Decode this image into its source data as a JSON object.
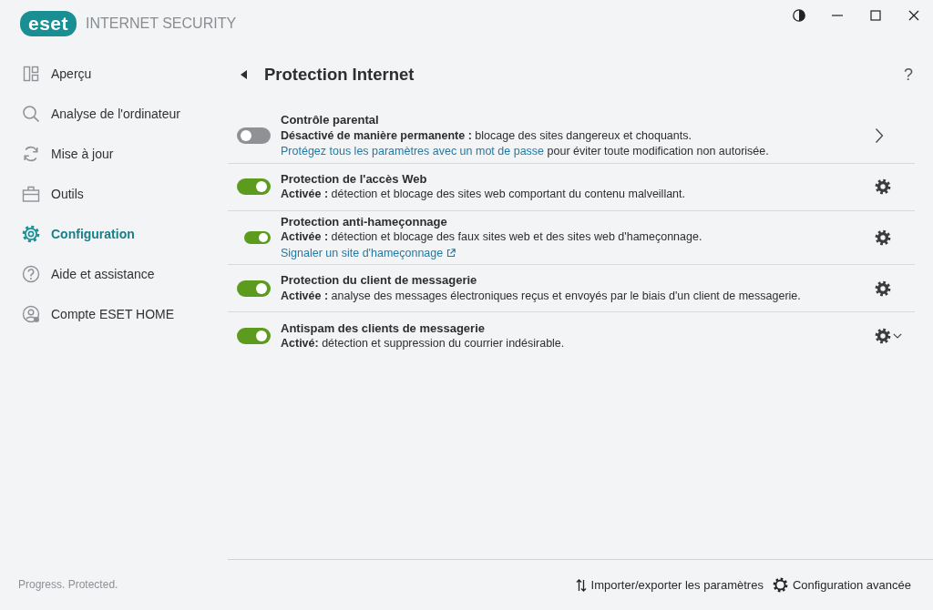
{
  "window": {
    "logo": "eset",
    "product": "INTERNET SECURITY"
  },
  "sidebar": {
    "items": [
      {
        "label": "Aperçu",
        "selected": false
      },
      {
        "label": "Analyse de l'ordinateur",
        "selected": false
      },
      {
        "label": "Mise à jour",
        "selected": false
      },
      {
        "label": "Outils",
        "selected": false
      },
      {
        "label": "Configuration",
        "selected": true
      },
      {
        "label": "Aide et assistance",
        "selected": false
      },
      {
        "label": "Compte ESET HOME",
        "selected": false
      }
    ],
    "tagline": "Progress. Protected."
  },
  "page": {
    "title": "Protection Internet",
    "help": "?"
  },
  "settings": [
    {
      "title": "Contrôle parental",
      "switch": {
        "kind": "regular",
        "on": false
      },
      "kind": "page",
      "status": "**Désactivé de manière permanente :** blocage des sites dangereux et choquants.",
      "note": {
        "link": "Protégez tous les paramètres avec un mot de passe",
        "external": false,
        "after": "pour éviter toute modification non autorisée."
      }
    },
    {
      "title": "Protection de l'accès Web",
      "switch": {
        "kind": "regular",
        "on": true
      },
      "kind": "settings",
      "status": "**Activée :** détection et blocage des sites web comportant du contenu malveillant."
    },
    {
      "title": "Protection anti-hameçonnage",
      "switch": {
        "kind": "small",
        "on": true
      },
      "kind": "settings",
      "status": "**Activée :** détection et blocage des faux sites web et des sites web d'hameçonnage.",
      "note": {
        "link": "Signaler un site d'hameçonnage",
        "external": true
      }
    },
    {
      "title": "Protection du client de messagerie",
      "switch": {
        "kind": "regular",
        "on": true
      },
      "kind": "settings",
      "status": "**Activée :** analyse des messages électroniques reçus et envoyés par le biais d'un client de messagerie."
    },
    {
      "title": "Antispam des clients de messagerie",
      "switch": {
        "kind": "regular",
        "on": true
      },
      "kind": "menu",
      "status": "**Activé:** détection et suppression du courrier indésirable."
    }
  ],
  "footer": {
    "actions": [
      "Importer/exporter les paramètres",
      "Configuration avancée"
    ]
  }
}
